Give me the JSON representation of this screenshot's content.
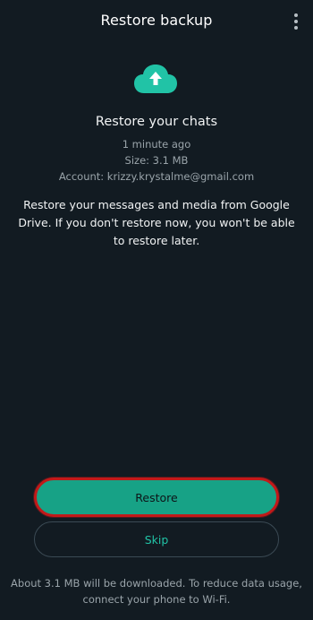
{
  "header": {
    "title": "Restore backup",
    "menu_icon": "more-vert-icon"
  },
  "hero": {
    "icon": "cloud-upload-icon",
    "icon_color": "#21c3a6"
  },
  "backup": {
    "heading": "Restore your chats",
    "time": "1 minute ago",
    "size": "Size: 3.1 MB",
    "account": "Account: krizzy.krystalme@gmail.com"
  },
  "description": "Restore your messages and media from Google Drive. If you don't restore now, you won't be able to restore later.",
  "actions": {
    "restore_label": "Restore",
    "skip_label": "Skip"
  },
  "footer": {
    "note": "About 3.1 MB will be downloaded. To reduce data usage, connect your phone to Wi-Fi."
  },
  "colors": {
    "background": "#121b22",
    "accent": "#17a286",
    "highlight_border": "#c21919"
  }
}
